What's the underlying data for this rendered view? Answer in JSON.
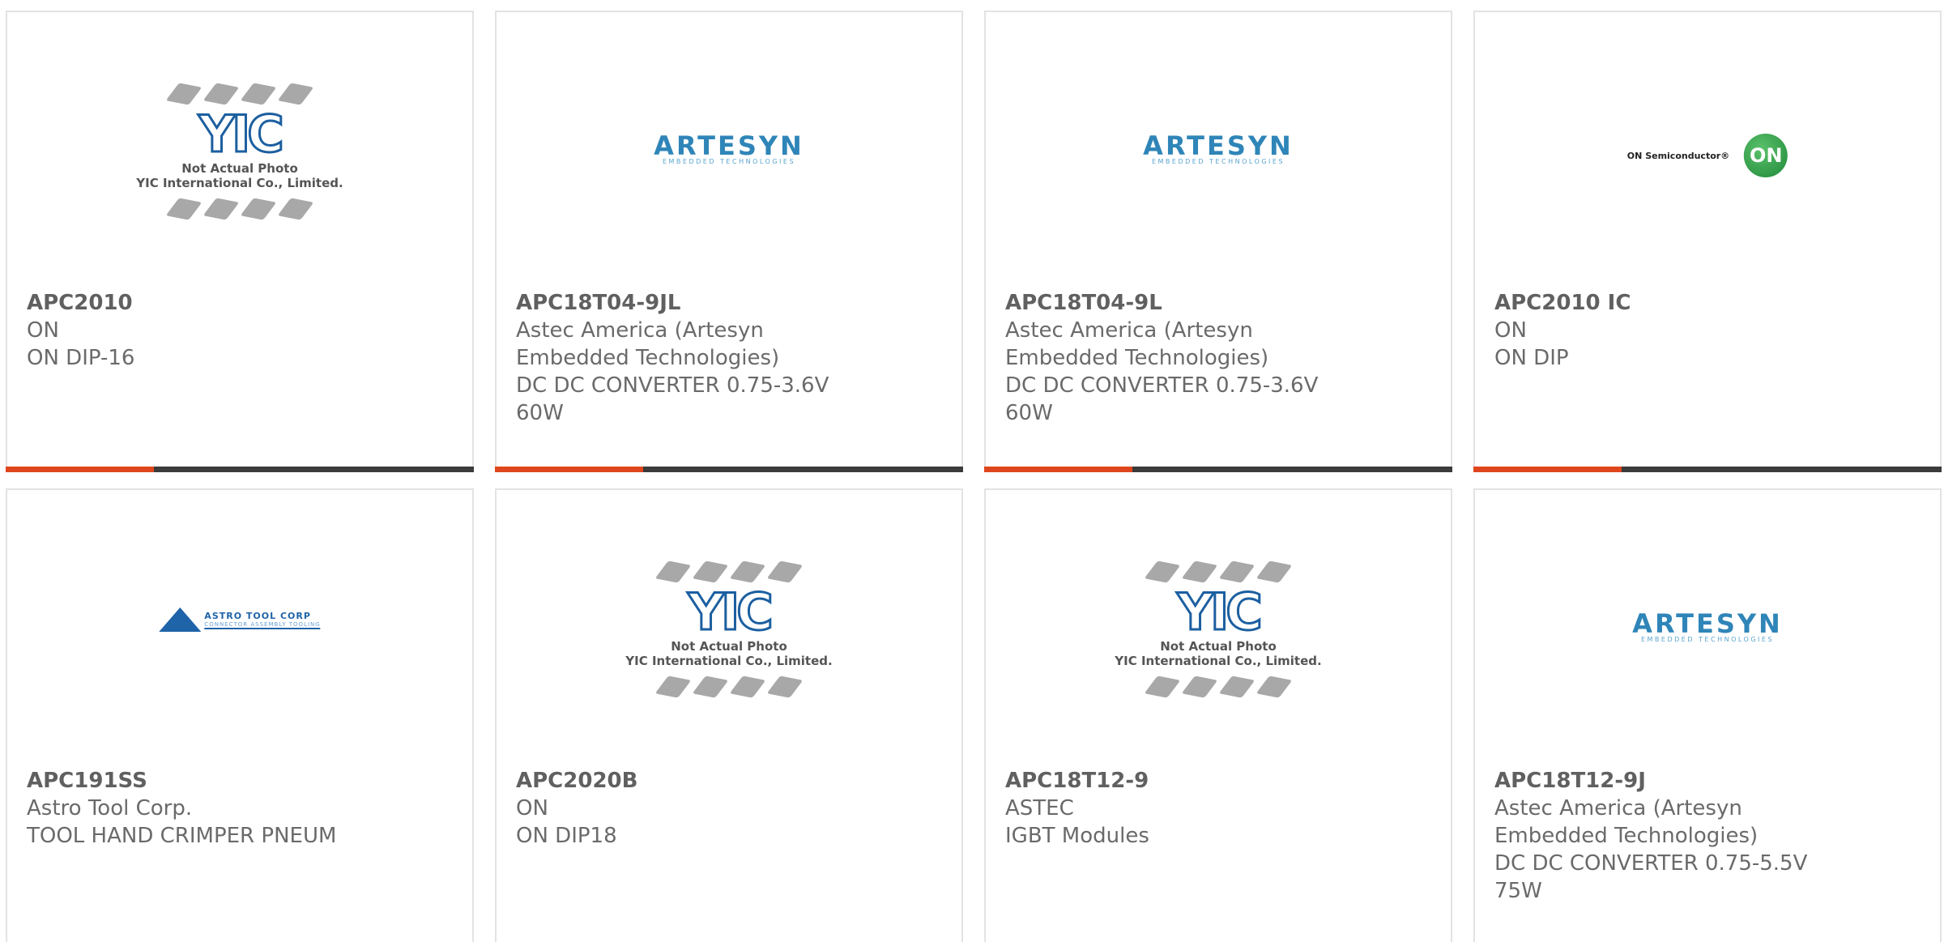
{
  "products": [
    {
      "part": "APC2010",
      "lines": [
        "ON",
        "ON DIP-16"
      ],
      "logo": "yic-placeholder"
    },
    {
      "part": "APC18T04-9JL",
      "lines": [
        "Astec America (Artesyn",
        "Embedded Technologies)",
        "DC DC CONVERTER 0.75-3.6V",
        "60W"
      ],
      "logo": "artesyn"
    },
    {
      "part": "APC18T04-9L",
      "lines": [
        "Astec America (Artesyn",
        "Embedded Technologies)",
        "DC DC CONVERTER 0.75-3.6V",
        "60W"
      ],
      "logo": "artesyn"
    },
    {
      "part": "APC2010 IC",
      "lines": [
        "ON",
        "ON DIP"
      ],
      "logo": "on-semiconductor"
    },
    {
      "part": "APC191SS",
      "lines": [
        "Astro Tool Corp.",
        "TOOL HAND CRIMPER PNEUM"
      ],
      "logo": "astro-tool-corp"
    },
    {
      "part": "APC2020B",
      "lines": [
        "ON",
        "ON DIP18"
      ],
      "logo": "yic-placeholder"
    },
    {
      "part": "APC18T12-9",
      "lines": [
        "ASTEC",
        "IGBT Modules"
      ],
      "logo": "yic-placeholder"
    },
    {
      "part": "APC18T12-9J",
      "lines": [
        "Astec America (Artesyn",
        "Embedded Technologies)",
        "DC DC CONVERTER 0.75-5.5V",
        "75W"
      ],
      "logo": "artesyn"
    }
  ],
  "logos": {
    "artesyn": {
      "word": "ARTESYN",
      "sub": "EMBEDDED TECHNOLOGIES"
    },
    "on": {
      "text": "ON Semiconductor®",
      "ball": "ON"
    },
    "astro": {
      "t1": "ASTRO TOOL CORP",
      "t2": "CONNECTOR ASSEMBLY TOOLING"
    },
    "yic": {
      "mark": "YIC",
      "cap1": "Not Actual Photo",
      "cap2": "YIC International Co., Limited."
    }
  },
  "colors": {
    "accent": "#e0461e",
    "bar": "#3b3b3b",
    "border": "#e3e3e3"
  }
}
